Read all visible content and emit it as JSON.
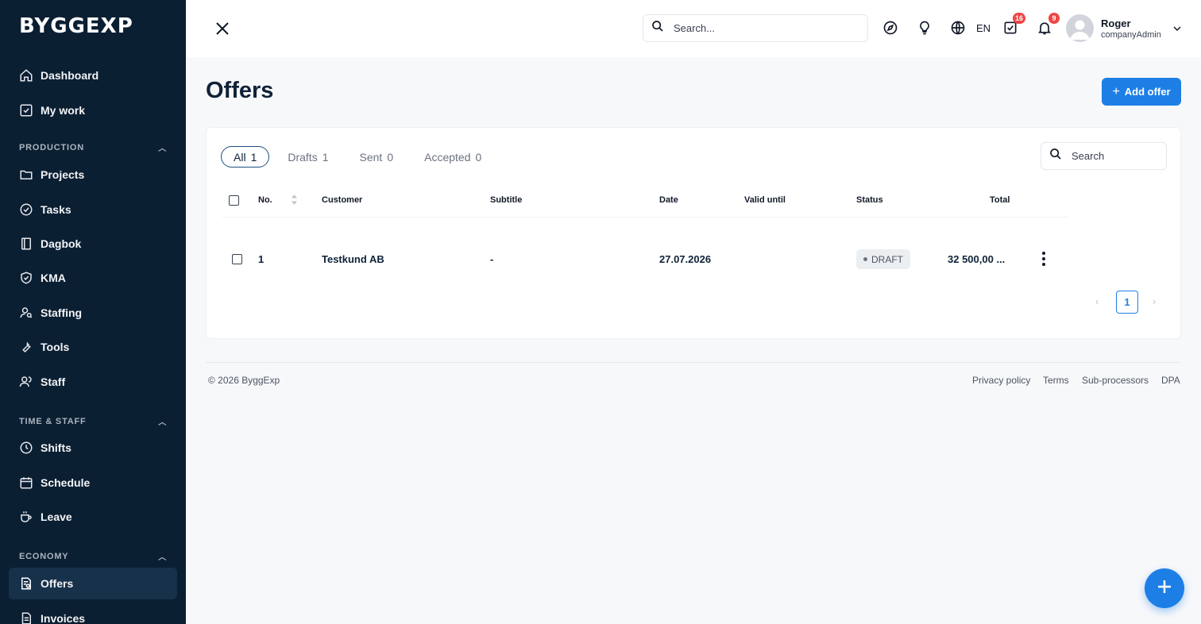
{
  "brand": {
    "logo_text": "BYGGEXP"
  },
  "sidebar": {
    "top_items": [
      {
        "label": "Dashboard",
        "icon": "home-icon"
      },
      {
        "label": "My work",
        "icon": "checkbox-icon"
      }
    ],
    "sections": [
      {
        "title": "PRODUCTION",
        "items": [
          {
            "label": "Projects",
            "icon": "folder-icon"
          },
          {
            "label": "Tasks",
            "icon": "check-circle-icon"
          },
          {
            "label": "Dagbok",
            "icon": "book-icon"
          },
          {
            "label": "KMA",
            "icon": "shield-check-icon"
          },
          {
            "label": "Staffing",
            "icon": "person-search-icon"
          },
          {
            "label": "Tools",
            "icon": "wrench-icon"
          },
          {
            "label": "Staff",
            "icon": "people-icon"
          }
        ]
      },
      {
        "title": "TIME & STAFF",
        "items": [
          {
            "label": "Shifts",
            "icon": "clock-icon"
          },
          {
            "label": "Schedule",
            "icon": "calendar-icon"
          },
          {
            "label": "Leave",
            "icon": "coffee-icon"
          }
        ]
      },
      {
        "title": "ECONOMY",
        "items": [
          {
            "label": "Offers",
            "icon": "offer-doc-icon",
            "active": true
          },
          {
            "label": "Invoices",
            "icon": "invoice-icon"
          }
        ]
      }
    ]
  },
  "topbar": {
    "search_placeholder": "Search...",
    "language": "EN",
    "tasks_badge": "16",
    "notifications_badge": "9",
    "user": {
      "name": "Roger",
      "role": "companyAdmin"
    }
  },
  "page": {
    "title": "Offers",
    "add_button": "Add offer",
    "tabs": [
      {
        "label": "All",
        "count": "1",
        "active": true
      },
      {
        "label": "Drafts",
        "count": "1"
      },
      {
        "label": "Sent",
        "count": "0"
      },
      {
        "label": "Accepted",
        "count": "0"
      }
    ],
    "search_placeholder": "Search",
    "columns": [
      "No.",
      "Customer",
      "Subtitle",
      "Date",
      "Valid until",
      "Status",
      "Total"
    ],
    "rows": [
      {
        "no": "1",
        "customer": "Testkund AB",
        "subtitle": "-",
        "date": "27.07.2026",
        "valid_until": "",
        "status": "DRAFT",
        "total": "32 500,00 ..."
      }
    ],
    "pagination": {
      "current": "1",
      "prev": "‹",
      "next": "›"
    }
  },
  "footer": {
    "copyright": "© 2026 ByggExp",
    "links": [
      "Privacy policy",
      "Terms",
      "Sub-processors",
      "DPA"
    ]
  },
  "colors": {
    "sidebar_bg": "#0b1f33",
    "accent": "#1d7fe6",
    "badge": "#ef4444"
  }
}
